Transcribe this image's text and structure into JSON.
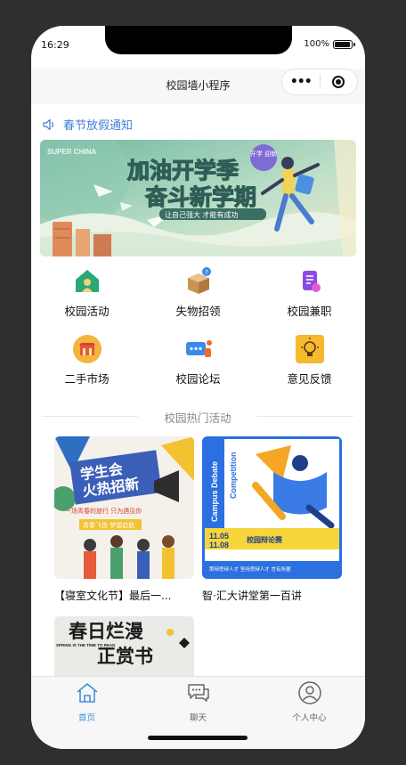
{
  "status": {
    "time": "16:29",
    "battery": "100%"
  },
  "navbar": {
    "title": "校园墙小程序",
    "menu_dots": "•••"
  },
  "notice": {
    "text": "春节放假通知"
  },
  "banner": {
    "brand": "SUPER CHINA",
    "headline_1": "加油开学季",
    "headline_2": "奋斗新学期",
    "tagline": "让自己强大  才能有成功",
    "badge": "开学\n迎新"
  },
  "grid": [
    {
      "label": "校园活动",
      "icon": "activity-icon"
    },
    {
      "label": "失物招领",
      "icon": "lost-found-icon"
    },
    {
      "label": "校园兼职",
      "icon": "part-time-icon"
    },
    {
      "label": "二手市场",
      "icon": "market-icon"
    },
    {
      "label": "校园论坛",
      "icon": "forum-icon"
    },
    {
      "label": "意见反馈",
      "icon": "feedback-icon"
    }
  ],
  "section": {
    "title": "校园热门活动"
  },
  "cards": [
    {
      "title": "【寝室文化节】最后一...",
      "poster_l1": "学生会",
      "poster_l2": "火热招新",
      "poster_sub": "一场青春的旅行 只为遇见你",
      "poster_tag": "青春飞扬  梦想启航"
    },
    {
      "title": "智·汇大讲堂第一百讲",
      "poster_l1": "Campus Debate",
      "poster_l2": "Competition",
      "poster_date_1": "11.05",
      "poster_date_2": "11.08",
      "poster_sub": "校园辩论赛",
      "poster_row": "策辩思辩人才  坚持思辩人才  言有所据"
    },
    {
      "title": "",
      "poster_l1": "春日烂漫",
      "poster_l2": "正赏书",
      "poster_side": "SPRING IS THE TIME TO READ"
    }
  ],
  "tabs": [
    {
      "label": "首页",
      "icon": "home-icon",
      "active": true
    },
    {
      "label": "聊天",
      "icon": "chat-icon",
      "active": false
    },
    {
      "label": "个人中心",
      "icon": "profile-icon",
      "active": false
    }
  ],
  "colors": {
    "accent": "#3f8fe0",
    "tab_inactive": "#666666",
    "section_gray": "#888888"
  }
}
